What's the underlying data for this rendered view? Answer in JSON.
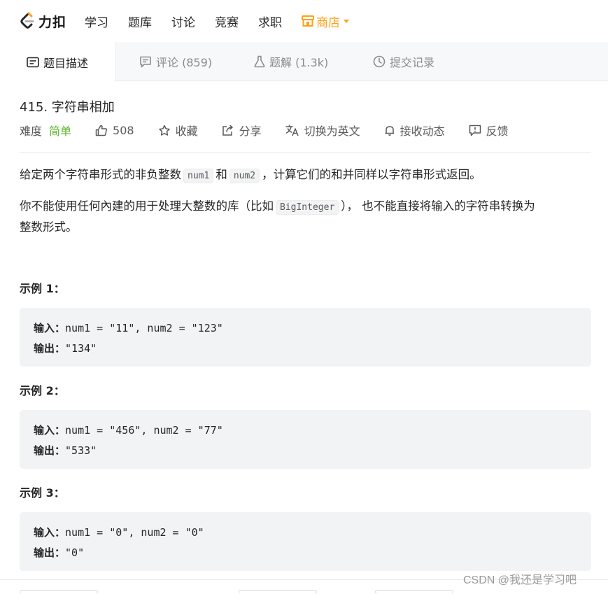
{
  "nav": {
    "brand": "力扣",
    "links": [
      "学习",
      "题库",
      "讨论",
      "竞赛",
      "求职"
    ],
    "store": "商店",
    "brand_color": "#ffa116"
  },
  "tabs": [
    {
      "label": "题目描述",
      "icon": "description-icon",
      "active": true
    },
    {
      "label": "评论 (859)",
      "icon": "comment-icon",
      "active": false
    },
    {
      "label": "题解 (1.3k)",
      "icon": "flask-icon",
      "active": false
    },
    {
      "label": "提交记录",
      "icon": "clock-icon",
      "active": false
    }
  ],
  "problem": {
    "title": "415. 字符串相加",
    "difficulty_label": "难度",
    "difficulty_value": "简单",
    "difficulty_color": "#5ab726",
    "likes": "508",
    "favorite": "收藏",
    "share": "分享",
    "translate": "切换为英文",
    "subscribe": "接收动态",
    "feedback": "反馈"
  },
  "description": {
    "p1_a": "给定两个字符串形式的非负整数",
    "p1_code1": "num1",
    "p1_b": "和",
    "p1_code2": "num2",
    "p1_c": "，计算它们的和并同样以字符串形式返回。",
    "p2_a": "你不能使用任何內建的用于处理大整数的库（比如",
    "p2_code": "BigInteger",
    "p2_b": "），  也不能直接将输入的字符串转换为",
    "p2_c": "整数形式。"
  },
  "examples": [
    {
      "title": "示例 1：",
      "input_label": "输入：",
      "input": "num1 = \"11\", num2 = \"123\"",
      "output_label": "输出：",
      "output": "\"134\""
    },
    {
      "title": "示例 2：",
      "input_label": "输入：",
      "input": "num1 = \"456\", num2 = \"77\"",
      "output_label": "输出：",
      "output": "\"533\""
    },
    {
      "title": "示例 3：",
      "input_label": "输入：",
      "input": "num1 = \"0\", num2 = \"0\"",
      "output_label": "输出：",
      "output": "\"0\""
    }
  ],
  "watermark": "CSDN @我还是学习吧"
}
